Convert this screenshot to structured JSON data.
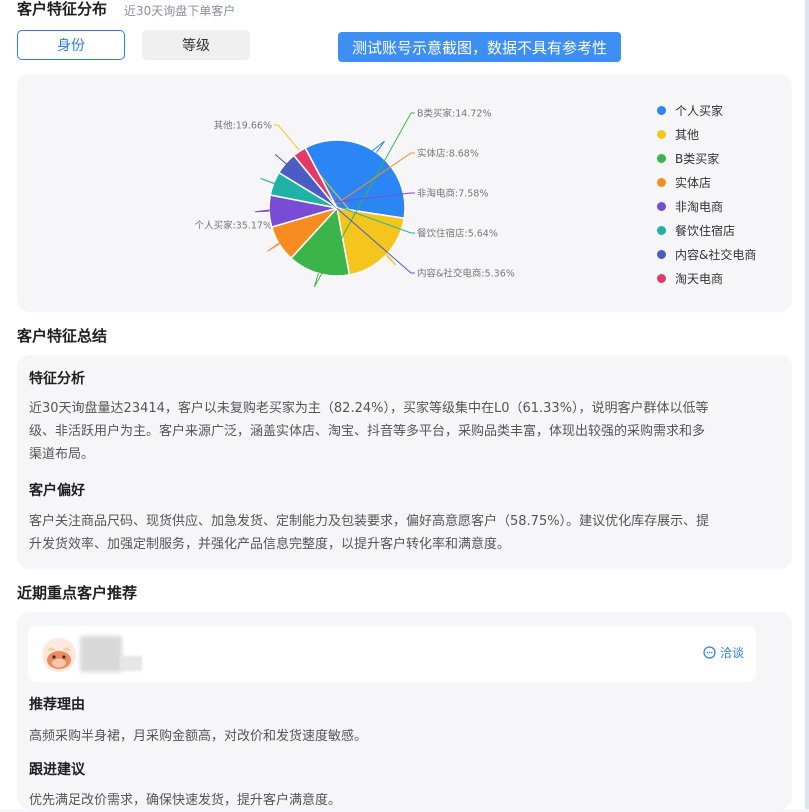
{
  "header": {
    "title": "客户特征分布",
    "subtitle": "近30天询盘下单客户",
    "tabs": [
      "身份",
      "等级"
    ],
    "notice": "测试账号示意截图，数据不具有参考性"
  },
  "chart_data": {
    "type": "pie",
    "slices": [
      {
        "name": "个人买家",
        "value": 35.17,
        "label": "个人买家:35.17%",
        "color": "#2b86f5"
      },
      {
        "name": "其他",
        "value": 19.66,
        "label": "其他:19.66%",
        "color": "#f4c51d"
      },
      {
        "name": "B类买家",
        "value": 14.72,
        "label": "B类买家:14.72%",
        "color": "#3bb54a"
      },
      {
        "name": "实体店",
        "value": 8.68,
        "label": "实体店:8.68%",
        "color": "#f68b1f"
      },
      {
        "name": "非淘电商",
        "value": 7.58,
        "label": "非淘电商:7.58%",
        "color": "#7a4cd6"
      },
      {
        "name": "餐饮住宿店",
        "value": 5.64,
        "label": "餐饮住宿店:5.64%",
        "color": "#1eb3a6"
      },
      {
        "name": "内容&社交电商",
        "value": 5.36,
        "label": "内容&社交电商:5.36%",
        "color": "#4b5cc4"
      },
      {
        "name": "淘天电商",
        "value": 3.19,
        "color": "#e23a6a"
      }
    ],
    "legend_position": "right"
  },
  "summary": {
    "title": "客户特征总结",
    "analysis_title": "特征分析",
    "analysis_lines": [
      "近30天询盘量达23414，客户以未复购老买家为主（82.24%），买家等级集中在L0（61.33%），说明客户群体以低等",
      "级、非活跃用户为主。客户来源广泛，涵盖实体店、淘宝、抖音等多平台，采购品类丰富，体现出较强的采购需求和多",
      "渠道布局。"
    ],
    "preference_title": "客户偏好",
    "preference_lines": [
      "客户关注商品尺码、现货供应、加急发货、定制能力及包装要求，偏好高意愿客户（58.75%）。建议优化库存展示、提",
      "升发货效率、加强定制服务，并强化产品信息完整度，以提升客户转化率和满意度。"
    ]
  },
  "recommend": {
    "title": "近期重点客户推荐",
    "chat_label": "洽谈",
    "reason_title": "推荐理由",
    "reason_text": "高频采购半身裙，月采购金额高，对改价和发货速度敏感。",
    "advice_title": "跟进建议",
    "advice_text": "优先满足改价需求，确保快速发货，提升客户满意度。"
  }
}
